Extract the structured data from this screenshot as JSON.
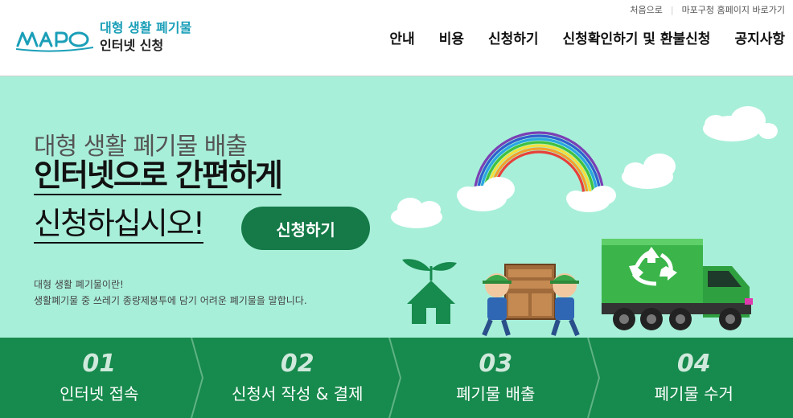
{
  "util_links": {
    "home": "처음으로",
    "mapo_homepage": "마포구청 홈페이지 바로가기"
  },
  "logo": {
    "mark": "MAPO",
    "line1": "대형 생활 폐기물",
    "line2": "인터넷 신청"
  },
  "nav": {
    "items": [
      {
        "label": "안내"
      },
      {
        "label": "비용"
      },
      {
        "label": "신청하기"
      },
      {
        "label": "신청확인하기 및 환불신청"
      },
      {
        "label": "공지사항"
      }
    ]
  },
  "hero": {
    "sub": "대형 생활 폐기물 배출",
    "title1": "인터넷으로 간편하게",
    "title2": "신청하십시오!",
    "apply_button": "신청하기",
    "question": "대형 생활 폐기물이란!",
    "answer": "생활폐기물 중 쓰레기 종량제봉투에 담기 어려운 폐기물을 말합니다."
  },
  "steps": [
    {
      "num": "01",
      "label": "인터넷 접속"
    },
    {
      "num": "02",
      "label": "신청서 작성 & 결제"
    },
    {
      "num": "03",
      "label": "폐기물 배출"
    },
    {
      "num": "04",
      "label": "폐기물 수거"
    }
  ],
  "colors": {
    "brand_teal": "#1b9fb8",
    "hero_bg": "#a8efd9",
    "primary_green": "#157a48",
    "steps_bg": "#178a4d",
    "truck_green": "#3bb54a"
  },
  "icons": {
    "recycle": "recycle-icon",
    "house": "house-plant-icon",
    "chevron": "chevron-right-icon"
  }
}
